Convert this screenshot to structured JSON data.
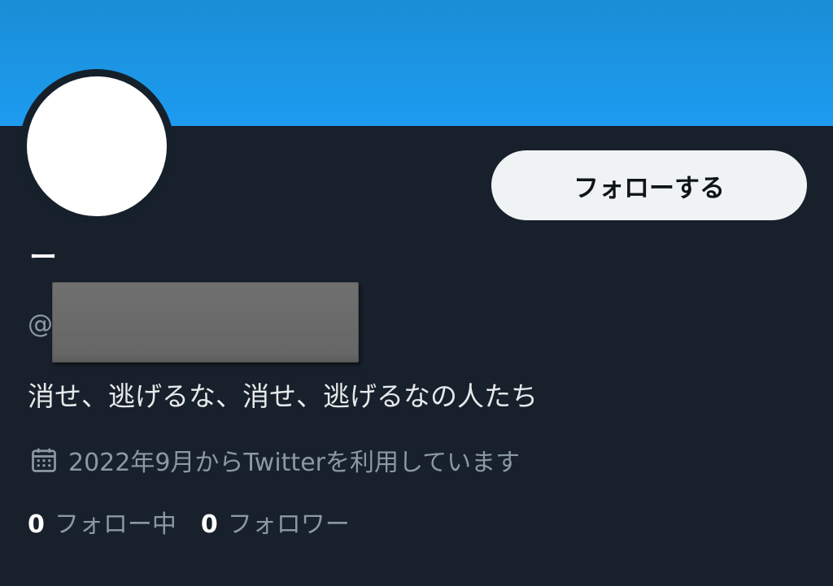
{
  "profile": {
    "display_name": "ー",
    "handle_prefix": "@",
    "bio": "消せ、逃げるな、消せ、逃げるなの人たち",
    "joined": "2022年9月からTwitterを利用しています",
    "follow_button_label": "フォローする",
    "following_count": "0",
    "following_label": "フォロー中",
    "followers_count": "0",
    "followers_label": "フォロワー"
  },
  "icons": {
    "calendar": "calendar-icon"
  },
  "colors": {
    "banner": "#1d9bf0",
    "background": "#15202b",
    "follow_button_bg": "#eff3f4",
    "secondary_text": "#8b98a5"
  }
}
